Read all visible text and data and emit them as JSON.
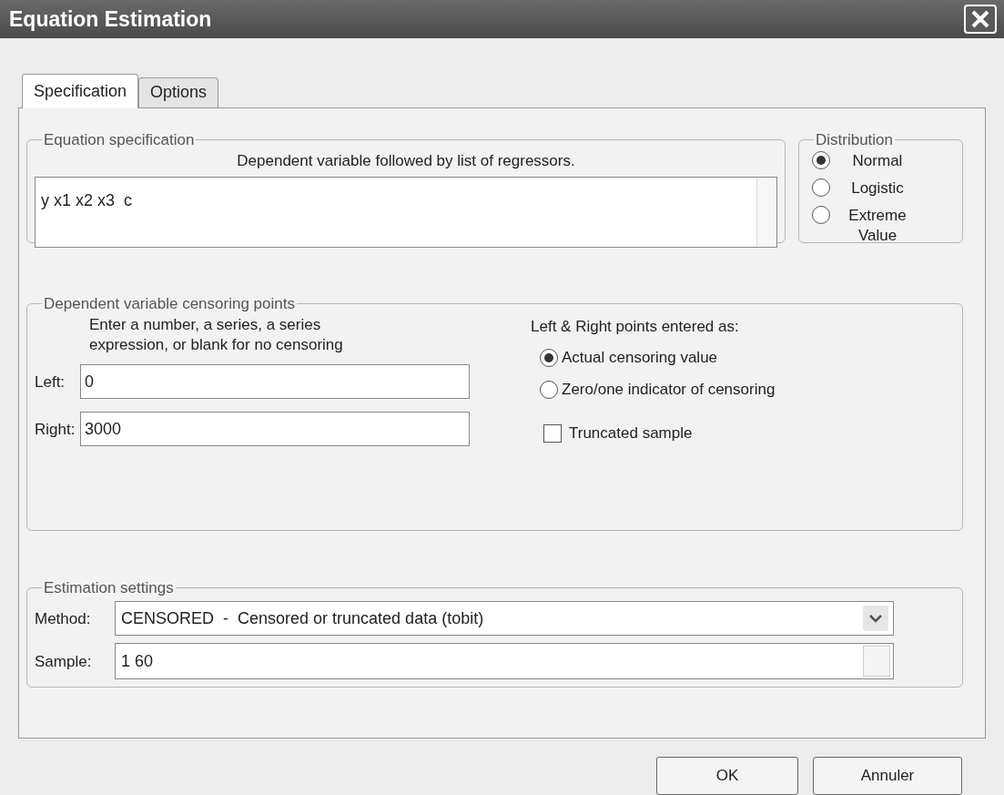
{
  "window": {
    "title": "Equation Estimation"
  },
  "tabs": [
    {
      "label": "Specification",
      "selected": true
    },
    {
      "label": "Options",
      "selected": false
    }
  ],
  "equation_specification": {
    "title": "Equation specification",
    "hint": "Dependent variable followed by list of regressors.",
    "value": "y x1 x2 x3  c"
  },
  "distribution": {
    "title": "Distribution",
    "options": [
      {
        "label": "Normal",
        "selected": true
      },
      {
        "label": "Logistic",
        "selected": false
      },
      {
        "label": "Extreme Value",
        "selected": false
      }
    ]
  },
  "censoring": {
    "title": "Dependent variable censoring points",
    "hint": "Enter a number, a series, a series expression, or blank for no censoring",
    "left": {
      "label": "Left:",
      "value": "0"
    },
    "right": {
      "label": "Right:",
      "value": "3000"
    },
    "entered_as": {
      "label": "Left & Right points entered as:",
      "options": [
        {
          "label": "Actual censoring value",
          "selected": true
        },
        {
          "label": "Zero/one indicator of censoring",
          "selected": false
        }
      ]
    },
    "truncated": {
      "label": "Truncated sample",
      "checked": false
    }
  },
  "estimation_settings": {
    "title": "Estimation settings",
    "method": {
      "label": "Method:",
      "value": "CENSORED  -  Censored or truncated data (tobit)"
    },
    "sample": {
      "label": "Sample:",
      "value": "1 60"
    }
  },
  "buttons": [
    "OK",
    "Annuler"
  ]
}
